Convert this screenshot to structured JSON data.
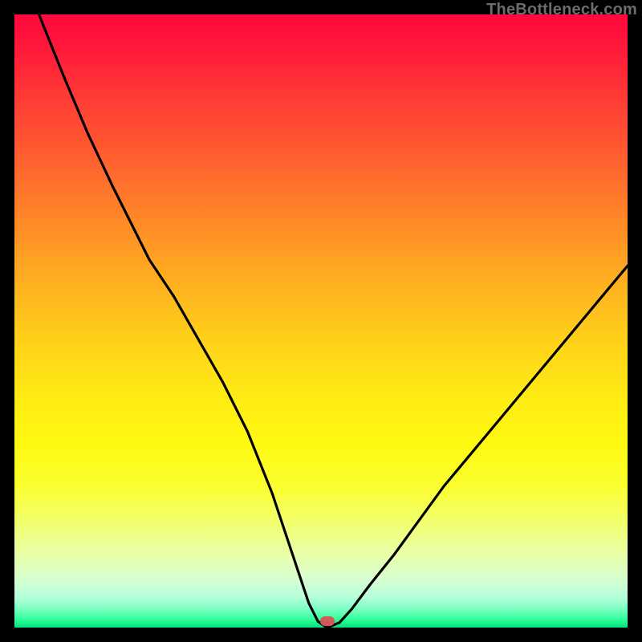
{
  "watermark": "TheBottleneck.com",
  "marker": {
    "x_pct": 51.0,
    "y_pct": 99.0,
    "color": "#cf5a58"
  },
  "chart_data": {
    "type": "line",
    "title": "",
    "xlabel": "",
    "ylabel": "",
    "xlim": [
      0,
      100
    ],
    "ylim": [
      0,
      100
    ],
    "grid": false,
    "legend": false,
    "x": [
      4,
      8,
      12,
      16,
      20,
      22,
      26,
      30,
      34,
      38,
      42,
      44,
      46,
      48,
      49.5,
      51,
      53,
      55,
      58,
      62,
      66,
      70,
      75,
      80,
      85,
      90,
      95,
      100
    ],
    "y": [
      100,
      90,
      80.5,
      72,
      64,
      60,
      54,
      47,
      40,
      32,
      22,
      16,
      10,
      4,
      1,
      0,
      0.8,
      3,
      7,
      12,
      17.5,
      23,
      29,
      35,
      41,
      47,
      53,
      59
    ],
    "series": [
      {
        "name": "bottleneck-curve",
        "color": "#000000",
        "stroke_width": 3
      }
    ],
    "annotations": [
      {
        "type": "marker",
        "x": 51,
        "y": 0.8,
        "shape": "pill",
        "color": "#cf5a58"
      }
    ],
    "background_gradient": {
      "direction": "vertical",
      "stops": [
        {
          "pos": 0.0,
          "color": "#ff083d"
        },
        {
          "pos": 0.3,
          "color": "#ff7a2a"
        },
        {
          "pos": 0.62,
          "color": "#ffea14"
        },
        {
          "pos": 0.88,
          "color": "#e9ffa8"
        },
        {
          "pos": 1.0,
          "color": "#00e57a"
        }
      ]
    }
  }
}
